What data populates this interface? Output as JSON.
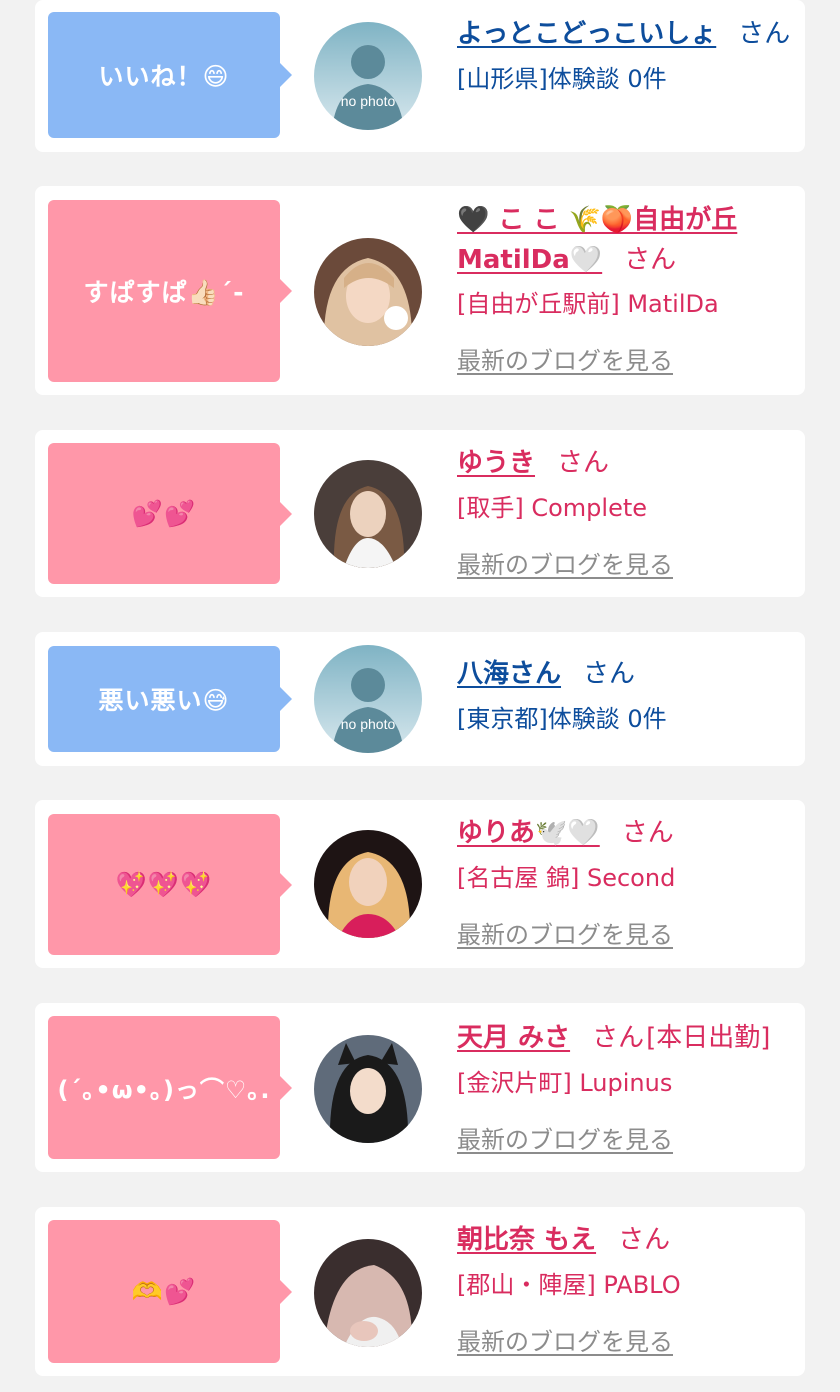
{
  "messages": [
    {
      "bubble": "いいね！😄",
      "color": "blue",
      "avatar": "no-photo",
      "avatar_text": "no photo",
      "name": "よっとこどっこいしょ",
      "honorific": "さん",
      "detail": "[山形県]体験談 0件",
      "blog_link": ""
    },
    {
      "bubble": "すぱすぱ👍🏻´-",
      "color": "pink",
      "avatar": "photo",
      "name": "🖤 こ こ 🌾🍑自由が丘MatilDa🤍",
      "honorific": "さん",
      "detail": "[自由が丘駅前] MatilDa",
      "blog_link": "最新のブログを見る"
    },
    {
      "bubble": "💕💕",
      "color": "pink",
      "avatar": "photo",
      "name": "ゆうき",
      "honorific": "さん",
      "detail": "[取手] Complete",
      "blog_link": "最新のブログを見る"
    },
    {
      "bubble": "悪い悪い😅",
      "color": "blue",
      "avatar": "no-photo",
      "avatar_text": "no photo",
      "name": "八海さん",
      "honorific": "さん",
      "detail": "[東京都]体験談 0件",
      "blog_link": ""
    },
    {
      "bubble": "💖💖💖",
      "color": "pink",
      "avatar": "photo",
      "name": "ゆりあ🕊️🤍",
      "honorific": "さん",
      "detail": "[名古屋 錦] Second",
      "blog_link": "最新のブログを見る"
    },
    {
      "bubble": "(´｡•ω•｡)っ⌒♡｡.",
      "color": "pink",
      "avatar": "photo",
      "name": "天月 みさ",
      "honorific": "さん",
      "badge": "[本日出勤]",
      "detail": "[金沢片町] Lupinus",
      "blog_link": "最新のブログを見る"
    },
    {
      "bubble": "🫶💕",
      "color": "pink",
      "avatar": "photo",
      "name": "朝比奈 もえ",
      "honorific": "さん",
      "detail": "[郡山・陣屋] PABLO",
      "blog_link": "最新のブログを見る"
    }
  ],
  "colors": {
    "bubble_blue": "#8ab8f5",
    "bubble_pink": "#ff97a9",
    "text_blue": "#0d4d9c",
    "text_pink": "#d92c5f",
    "link_gray": "#8c8c8c",
    "background": "#f2f2f2"
  }
}
